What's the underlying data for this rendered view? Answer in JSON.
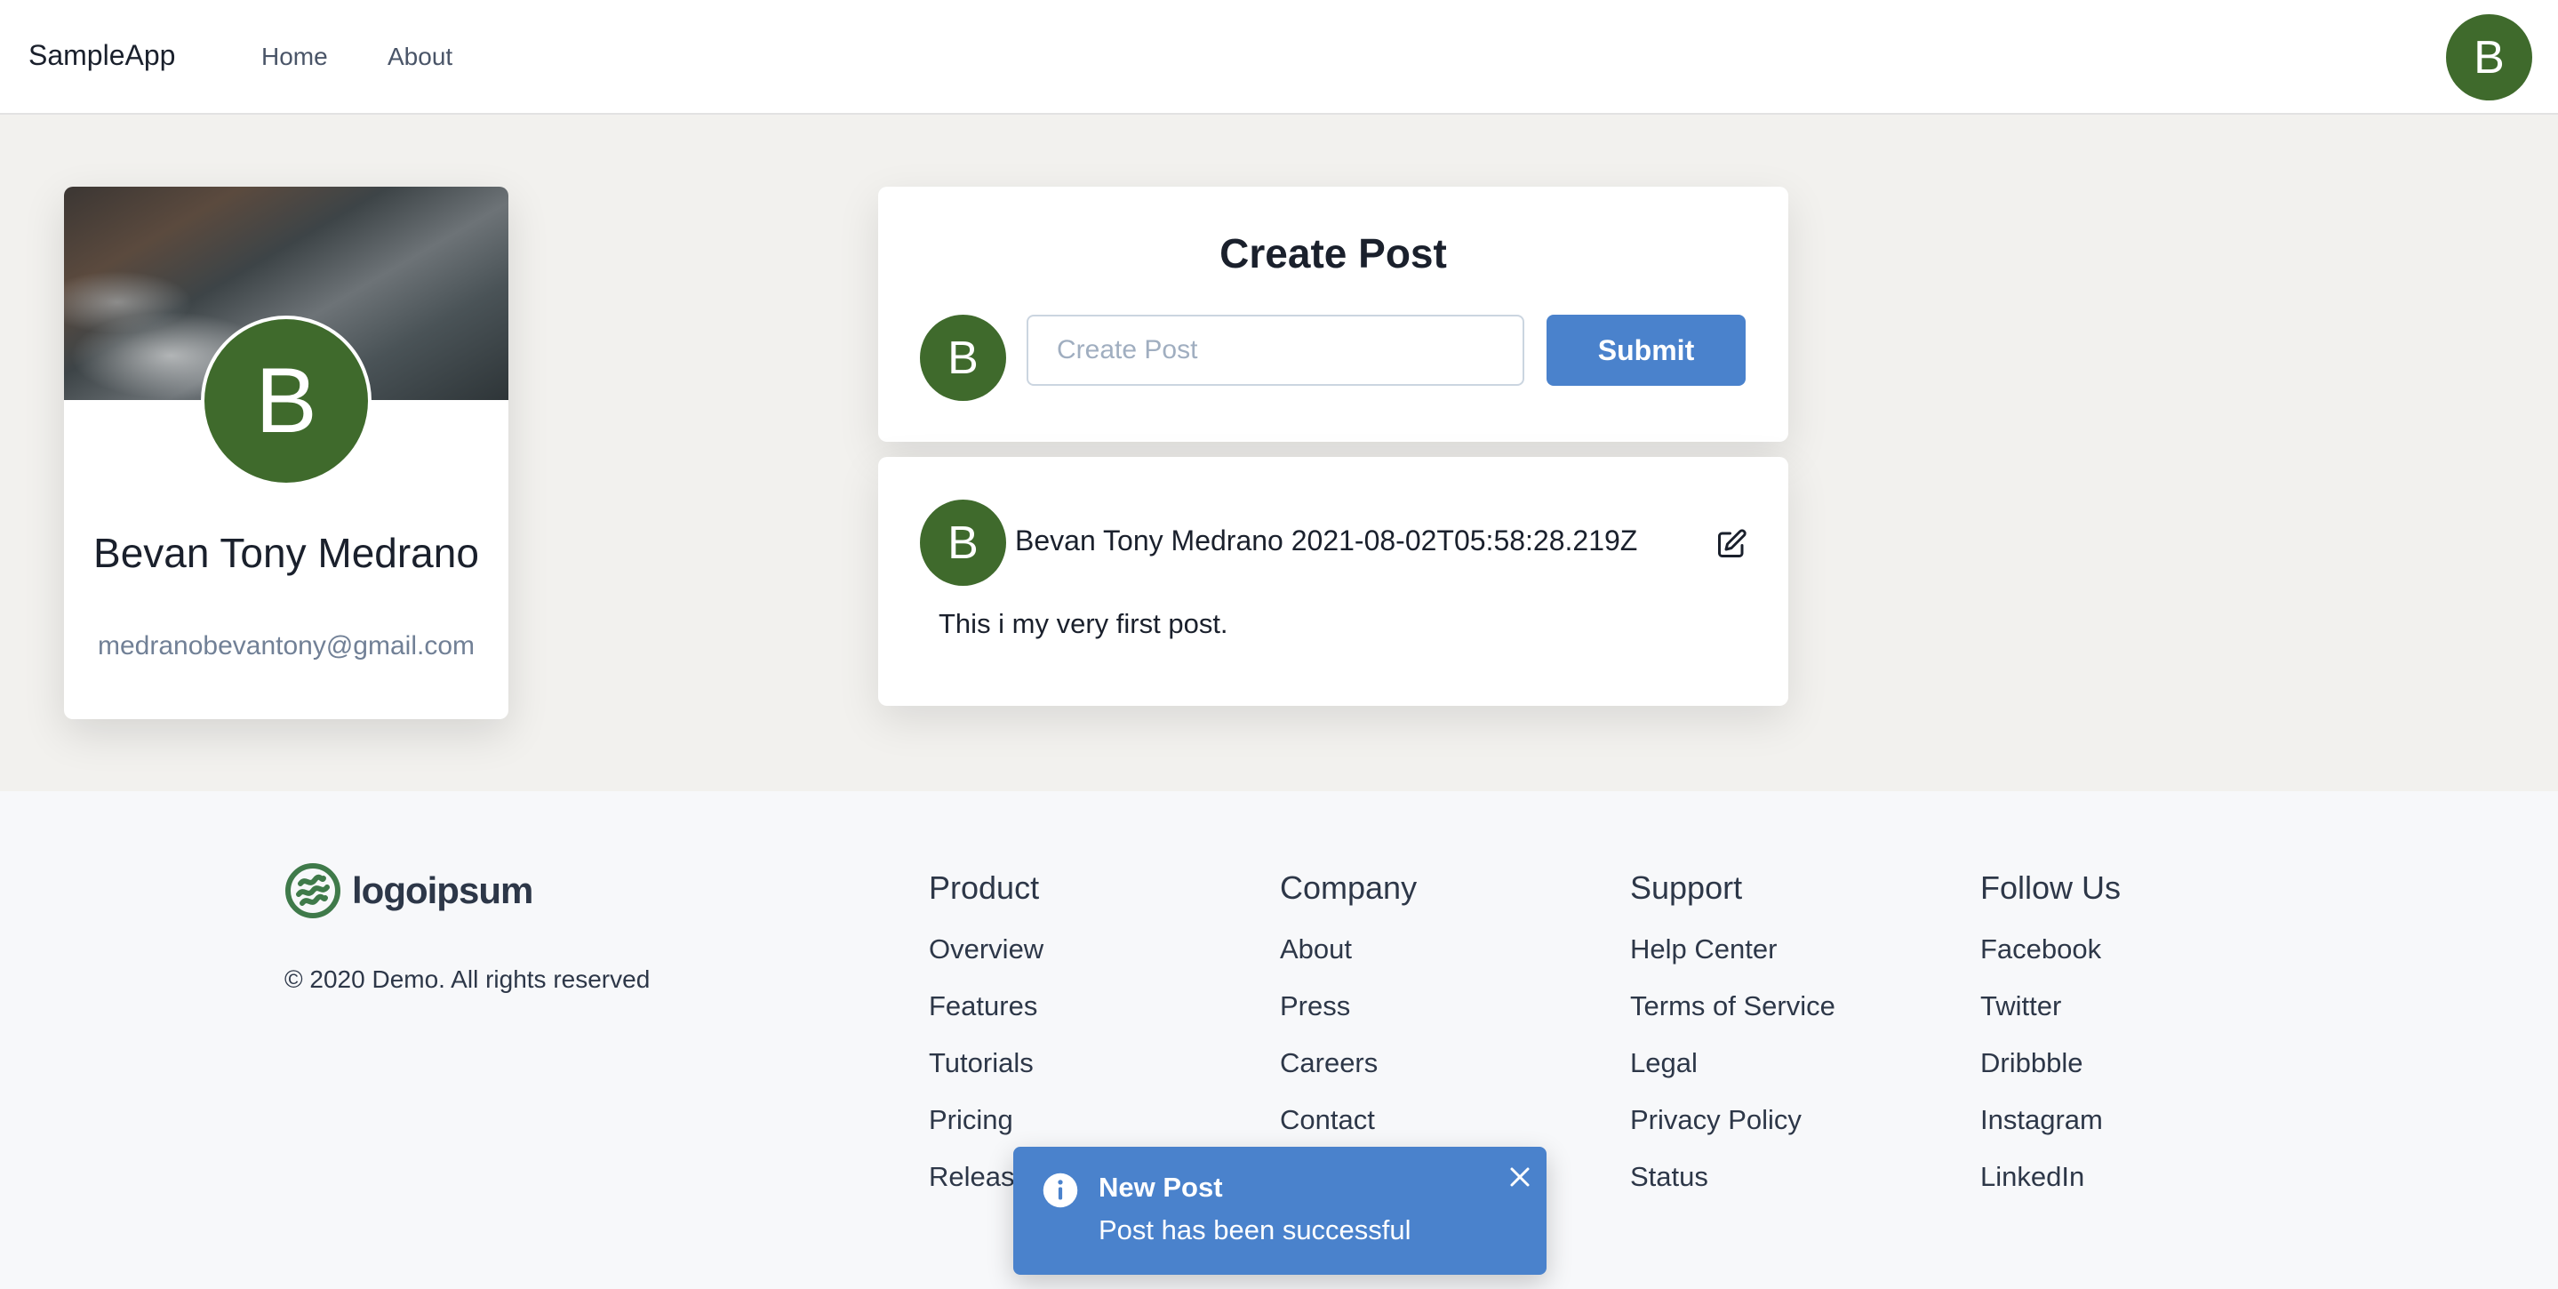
{
  "nav": {
    "brand": "SampleApp",
    "links": [
      "Home",
      "About"
    ],
    "avatar_initial": "B"
  },
  "profile": {
    "initial": "B",
    "name": "Bevan Tony Medrano",
    "email": "medranobevantony@gmail.com"
  },
  "create_post": {
    "title": "Create Post",
    "avatar_initial": "B",
    "placeholder": "Create Post",
    "submit_label": "Submit"
  },
  "post": {
    "avatar_initial": "B",
    "author": "Bevan Tony Medrano",
    "timestamp": "2021-08-02T05:58:28.219Z",
    "body": "This i my very first post.",
    "edit_icon": "edit-icon"
  },
  "footer": {
    "logo_text": "logoipsum",
    "copyright": "© 2020 Demo. All rights reserved",
    "columns": [
      {
        "title": "Product",
        "links": [
          "Overview",
          "Features",
          "Tutorials",
          "Pricing",
          "Releases"
        ]
      },
      {
        "title": "Company",
        "links": [
          "About",
          "Press",
          "Careers",
          "Contact"
        ]
      },
      {
        "title": "Support",
        "links": [
          "Help Center",
          "Terms of Service",
          "Legal",
          "Privacy Policy",
          "Status"
        ]
      },
      {
        "title": "Follow Us",
        "links": [
          "Facebook",
          "Twitter",
          "Dribbble",
          "Instagram",
          "LinkedIn"
        ]
      }
    ]
  },
  "toast": {
    "title": "New Post",
    "message": "Post has been successful",
    "icon": "info-icon"
  },
  "colors": {
    "accent": "#4a82cc",
    "avatar": "#3f6a2c",
    "page_bg": "#f2f1ee",
    "footer_bg": "#f7f8fa"
  }
}
